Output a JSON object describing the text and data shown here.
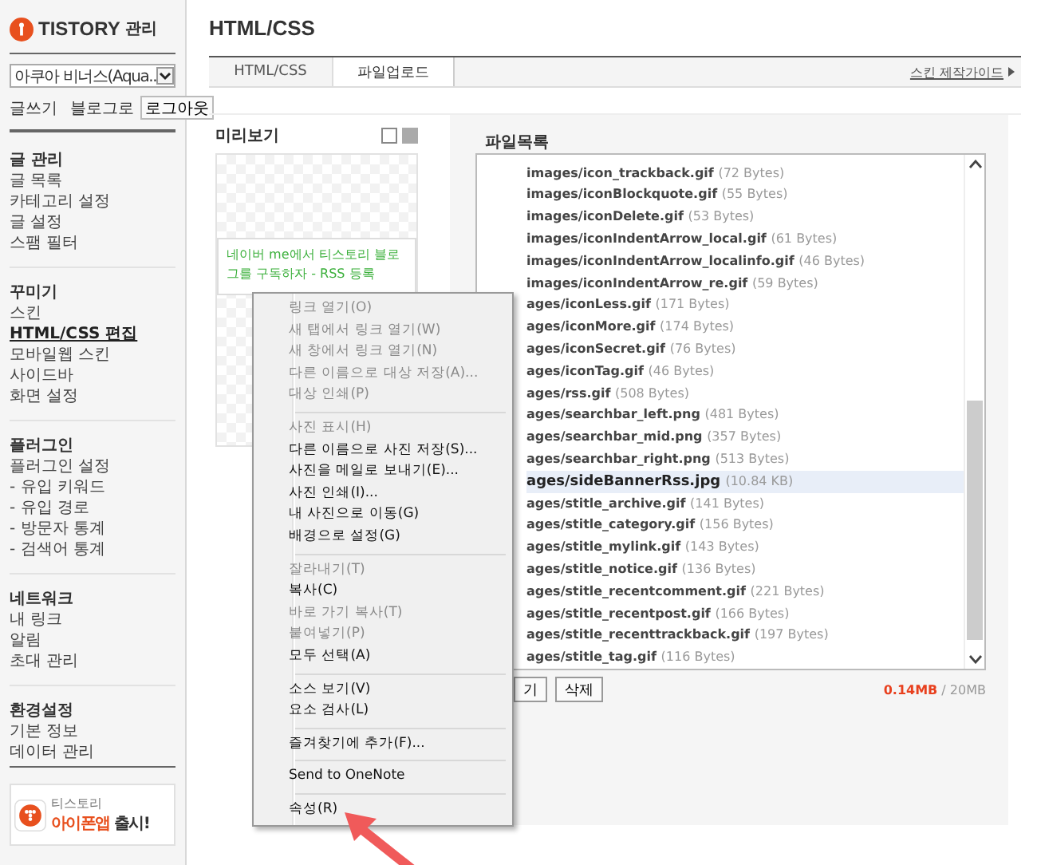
{
  "sidebar": {
    "logo": "TISTORY",
    "logo_suffix": "관리",
    "blog_select": {
      "value": "아쿠아 비너스(Aqua.."
    },
    "links": [
      "글쓰기",
      "블로그로"
    ],
    "logout_button": "로그아웃",
    "sections": [
      {
        "title": "글 관리",
        "items": [
          {
            "label": "글 목록",
            "selected": false
          },
          {
            "label": "카테고리 설정",
            "selected": false
          },
          {
            "label": "글 설정",
            "selected": false
          },
          {
            "label": "스팸 필터",
            "selected": false
          }
        ]
      },
      {
        "title": "꾸미기",
        "items": [
          {
            "label": "스킨",
            "selected": false
          },
          {
            "label": "HTML/CSS 편집",
            "selected": true
          },
          {
            "label": "모바일웹 스킨",
            "selected": false
          },
          {
            "label": "사이드바",
            "selected": false
          },
          {
            "label": "화면 설정",
            "selected": false
          }
        ]
      },
      {
        "title": "플러그인",
        "items": [
          {
            "label": "플러그인 설정",
            "selected": false
          },
          {
            "label": "- 유입 키워드",
            "selected": false
          },
          {
            "label": "- 유입 경로",
            "selected": false
          },
          {
            "label": "- 방문자 통계",
            "selected": false
          },
          {
            "label": "- 검색어 통계",
            "selected": false
          }
        ]
      },
      {
        "title": "네트워크",
        "items": [
          {
            "label": "내 링크",
            "selected": false
          },
          {
            "label": "알림",
            "selected": false
          },
          {
            "label": "초대 관리",
            "selected": false
          }
        ]
      },
      {
        "title": "환경설정",
        "items": [
          {
            "label": "기본 정보",
            "selected": false
          },
          {
            "label": "데이터 관리",
            "selected": false
          }
        ]
      }
    ],
    "banner": {
      "small": "티스토리",
      "highlight": "아이폰앱",
      "rest": "출시!"
    }
  },
  "page_title": "HTML/CSS",
  "tabs": [
    {
      "label": "HTML/CSS",
      "selected": false
    },
    {
      "label": "파일업로드",
      "selected": true
    }
  ],
  "guide_link": "스킨 제작가이드",
  "preview": {
    "title": "미리보기",
    "banner_text": "네이버 me에서 티스토리 블로그를 구독하자 - RSS 등록"
  },
  "files": {
    "title": "파일목록",
    "rows": [
      {
        "name": "images/icon_trackback.gif",
        "size": "(72 Bytes)",
        "selected": false
      },
      {
        "name": "images/iconBlockquote.gif",
        "size": "(55 Bytes)",
        "selected": false
      },
      {
        "name": "images/iconDelete.gif",
        "size": "(53 Bytes)",
        "selected": false
      },
      {
        "name": "images/iconIndentArrow_local.gif",
        "size": "(61 Bytes)",
        "selected": false
      },
      {
        "name": "images/iconIndentArrow_localinfo.gif",
        "size": "(46 Bytes)",
        "selected": false
      },
      {
        "name": "images/iconIndentArrow_re.gif",
        "size": "(59 Bytes)",
        "selected": false
      },
      {
        "name": "ages/iconLess.gif",
        "size": "(171 Bytes)",
        "selected": false
      },
      {
        "name": "ages/iconMore.gif",
        "size": "(174 Bytes)",
        "selected": false
      },
      {
        "name": "ages/iconSecret.gif",
        "size": "(76 Bytes)",
        "selected": false
      },
      {
        "name": "ages/iconTag.gif",
        "size": "(46 Bytes)",
        "selected": false
      },
      {
        "name": "ages/rss.gif",
        "size": "(508 Bytes)",
        "selected": false
      },
      {
        "name": "ages/searchbar_left.png",
        "size": "(481 Bytes)",
        "selected": false
      },
      {
        "name": "ages/searchbar_mid.png",
        "size": "(357 Bytes)",
        "selected": false
      },
      {
        "name": "ages/searchbar_right.png",
        "size": "(513 Bytes)",
        "selected": false
      },
      {
        "name": "ages/sideBannerRss.jpg",
        "size": "(10.84 KB)",
        "selected": true
      },
      {
        "name": "ages/stitle_archive.gif",
        "size": "(141 Bytes)",
        "selected": false
      },
      {
        "name": "ages/stitle_category.gif",
        "size": "(156 Bytes)",
        "selected": false
      },
      {
        "name": "ages/stitle_mylink.gif",
        "size": "(143 Bytes)",
        "selected": false
      },
      {
        "name": "ages/stitle_notice.gif",
        "size": "(136 Bytes)",
        "selected": false
      },
      {
        "name": "ages/stitle_recentcomment.gif",
        "size": "(221 Bytes)",
        "selected": false
      },
      {
        "name": "ages/stitle_recentpost.gif",
        "size": "(166 Bytes)",
        "selected": false
      },
      {
        "name": "ages/stitle_recenttrackback.gif",
        "size": "(197 Bytes)",
        "selected": false
      },
      {
        "name": "ages/stitle_tag.gif",
        "size": "(116 Bytes)",
        "selected": false
      }
    ],
    "buttons": [
      "기",
      "삭제"
    ],
    "usage": {
      "used": "0.14MB",
      "total": "/ 20MB"
    }
  },
  "context_menu": {
    "groups": [
      {
        "items": [
          {
            "label": "링크 열기(O)",
            "disabled": true
          },
          {
            "label": "새 탭에서 링크 열기(W)",
            "disabled": true
          },
          {
            "label": "새 창에서 링크 열기(N)",
            "disabled": true
          },
          {
            "label": "다른 이름으로 대상 저장(A)...",
            "disabled": true
          },
          {
            "label": "대상 인쇄(P)",
            "disabled": true
          }
        ]
      },
      {
        "items": [
          {
            "label": "사진 표시(H)",
            "disabled": true
          },
          {
            "label": "다른 이름으로 사진 저장(S)...",
            "disabled": false
          },
          {
            "label": "사진을 메일로 보내기(E)...",
            "disabled": false
          },
          {
            "label": "사진 인쇄(I)...",
            "disabled": false
          },
          {
            "label": "내 사진으로 이동(G)",
            "disabled": false
          },
          {
            "label": "배경으로 설정(G)",
            "disabled": false
          }
        ]
      },
      {
        "items": [
          {
            "label": "잘라내기(T)",
            "disabled": true
          },
          {
            "label": "복사(C)",
            "disabled": false
          },
          {
            "label": "바로 가기 복사(T)",
            "disabled": true
          },
          {
            "label": "붙여넣기(P)",
            "disabled": true
          },
          {
            "label": "모두 선택(A)",
            "disabled": false
          }
        ]
      },
      {
        "items": [
          {
            "label": "소스 보기(V)",
            "disabled": false
          },
          {
            "label": "요소 검사(L)",
            "disabled": false
          }
        ]
      },
      {
        "items": [
          {
            "label": "즐겨찾기에 추가(F)...",
            "disabled": false
          }
        ]
      },
      {
        "items": [
          {
            "label": "Send to OneNote",
            "disabled": false
          }
        ]
      },
      {
        "items": [
          {
            "label": "속성(R)",
            "disabled": false
          }
        ]
      }
    ]
  }
}
